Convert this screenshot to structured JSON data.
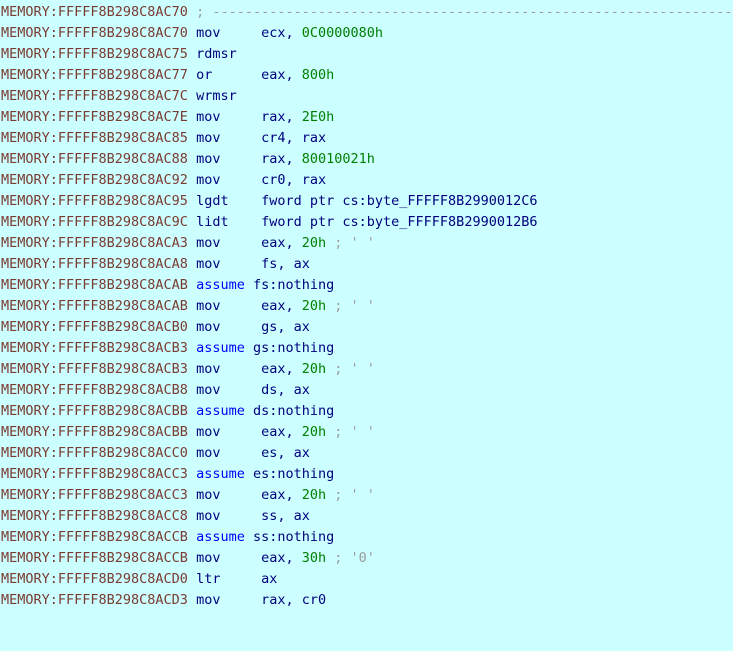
{
  "view": {
    "name": "IDA Pro disassembly listing",
    "segment": "MEMORY",
    "background_color": "#ccffff",
    "colors": {
      "segment_prefix": "#7a3b30",
      "mnemonic": "#00007f",
      "register": "#00007f",
      "number": "#008000",
      "keyword": "#0000ff",
      "comment": "#9a9a9a"
    }
  },
  "lines": [
    {
      "prefix": "MEMORY:FFFFF8B298C8AC70",
      "tokens": [
        {
          "t": "comment",
          "v": "; ---------------------------------------------------------------------------"
        }
      ]
    },
    {
      "prefix": "MEMORY:FFFFF8B298C8AC70",
      "tokens": [
        {
          "t": "mnem",
          "v": "mov     "
        },
        {
          "t": "reg",
          "v": "ecx, "
        },
        {
          "t": "num",
          "v": "0C0000080h"
        }
      ]
    },
    {
      "prefix": "MEMORY:FFFFF8B298C8AC75",
      "tokens": [
        {
          "t": "mnem",
          "v": "rdmsr"
        }
      ]
    },
    {
      "prefix": "MEMORY:FFFFF8B298C8AC77",
      "tokens": [
        {
          "t": "mnem",
          "v": "or      "
        },
        {
          "t": "reg",
          "v": "eax, "
        },
        {
          "t": "num",
          "v": "800h"
        }
      ]
    },
    {
      "prefix": "MEMORY:FFFFF8B298C8AC7C",
      "tokens": [
        {
          "t": "mnem",
          "v": "wrmsr"
        }
      ]
    },
    {
      "prefix": "MEMORY:FFFFF8B298C8AC7E",
      "tokens": [
        {
          "t": "mnem",
          "v": "mov     "
        },
        {
          "t": "reg",
          "v": "rax, "
        },
        {
          "t": "num",
          "v": "2E0h"
        }
      ]
    },
    {
      "prefix": "MEMORY:FFFFF8B298C8AC85",
      "tokens": [
        {
          "t": "mnem",
          "v": "mov     "
        },
        {
          "t": "reg",
          "v": "cr4, rax"
        }
      ]
    },
    {
      "prefix": "MEMORY:FFFFF8B298C8AC88",
      "tokens": [
        {
          "t": "mnem",
          "v": "mov     "
        },
        {
          "t": "reg",
          "v": "rax, "
        },
        {
          "t": "num",
          "v": "80010021h"
        }
      ]
    },
    {
      "prefix": "MEMORY:FFFFF8B298C8AC92",
      "tokens": [
        {
          "t": "mnem",
          "v": "mov     "
        },
        {
          "t": "reg",
          "v": "cr0, rax"
        }
      ]
    },
    {
      "prefix": "MEMORY:FFFFF8B298C8AC95",
      "tokens": [
        {
          "t": "mnem",
          "v": "lgdt    "
        },
        {
          "t": "reg",
          "v": "fword ptr cs:"
        },
        {
          "t": "name",
          "v": "byte_FFFFF8B2990012C6"
        }
      ]
    },
    {
      "prefix": "MEMORY:FFFFF8B298C8AC9C",
      "tokens": [
        {
          "t": "mnem",
          "v": "lidt    "
        },
        {
          "t": "reg",
          "v": "fword ptr cs:"
        },
        {
          "t": "name",
          "v": "byte_FFFFF8B2990012B6"
        }
      ]
    },
    {
      "prefix": "MEMORY:FFFFF8B298C8ACA3",
      "tokens": [
        {
          "t": "mnem",
          "v": "mov     "
        },
        {
          "t": "reg",
          "v": "eax, "
        },
        {
          "t": "num",
          "v": "20h"
        },
        {
          "t": "comment",
          "v": " ; ' '"
        }
      ]
    },
    {
      "prefix": "MEMORY:FFFFF8B298C8ACA8",
      "tokens": [
        {
          "t": "mnem",
          "v": "mov     "
        },
        {
          "t": "reg",
          "v": "fs, ax"
        }
      ]
    },
    {
      "prefix": "MEMORY:FFFFF8B298C8ACAB",
      "tokens": [
        {
          "t": "keyword",
          "v": "assume "
        },
        {
          "t": "dirtext",
          "v": "fs:nothing"
        }
      ]
    },
    {
      "prefix": "MEMORY:FFFFF8B298C8ACAB",
      "tokens": [
        {
          "t": "mnem",
          "v": "mov     "
        },
        {
          "t": "reg",
          "v": "eax, "
        },
        {
          "t": "num",
          "v": "20h"
        },
        {
          "t": "comment",
          "v": " ; ' '"
        }
      ]
    },
    {
      "prefix": "MEMORY:FFFFF8B298C8ACB0",
      "tokens": [
        {
          "t": "mnem",
          "v": "mov     "
        },
        {
          "t": "reg",
          "v": "gs, ax"
        }
      ]
    },
    {
      "prefix": "MEMORY:FFFFF8B298C8ACB3",
      "tokens": [
        {
          "t": "keyword",
          "v": "assume "
        },
        {
          "t": "dirtext",
          "v": "gs:nothing"
        }
      ]
    },
    {
      "prefix": "MEMORY:FFFFF8B298C8ACB3",
      "tokens": [
        {
          "t": "mnem",
          "v": "mov     "
        },
        {
          "t": "reg",
          "v": "eax, "
        },
        {
          "t": "num",
          "v": "20h"
        },
        {
          "t": "comment",
          "v": " ; ' '"
        }
      ]
    },
    {
      "prefix": "MEMORY:FFFFF8B298C8ACB8",
      "tokens": [
        {
          "t": "mnem",
          "v": "mov     "
        },
        {
          "t": "reg",
          "v": "ds, ax"
        }
      ]
    },
    {
      "prefix": "MEMORY:FFFFF8B298C8ACBB",
      "tokens": [
        {
          "t": "keyword",
          "v": "assume "
        },
        {
          "t": "dirtext",
          "v": "ds:nothing"
        }
      ]
    },
    {
      "prefix": "MEMORY:FFFFF8B298C8ACBB",
      "tokens": [
        {
          "t": "mnem",
          "v": "mov     "
        },
        {
          "t": "reg",
          "v": "eax, "
        },
        {
          "t": "num",
          "v": "20h"
        },
        {
          "t": "comment",
          "v": " ; ' '"
        }
      ]
    },
    {
      "prefix": "MEMORY:FFFFF8B298C8ACC0",
      "tokens": [
        {
          "t": "mnem",
          "v": "mov     "
        },
        {
          "t": "reg",
          "v": "es, ax"
        }
      ]
    },
    {
      "prefix": "MEMORY:FFFFF8B298C8ACC3",
      "tokens": [
        {
          "t": "keyword",
          "v": "assume "
        },
        {
          "t": "dirtext",
          "v": "es:nothing"
        }
      ]
    },
    {
      "prefix": "MEMORY:FFFFF8B298C8ACC3",
      "tokens": [
        {
          "t": "mnem",
          "v": "mov     "
        },
        {
          "t": "reg",
          "v": "eax, "
        },
        {
          "t": "num",
          "v": "20h"
        },
        {
          "t": "comment",
          "v": " ; ' '"
        }
      ]
    },
    {
      "prefix": "MEMORY:FFFFF8B298C8ACC8",
      "tokens": [
        {
          "t": "mnem",
          "v": "mov     "
        },
        {
          "t": "reg",
          "v": "ss, ax"
        }
      ]
    },
    {
      "prefix": "MEMORY:FFFFF8B298C8ACCB",
      "tokens": [
        {
          "t": "keyword",
          "v": "assume "
        },
        {
          "t": "dirtext",
          "v": "ss:nothing"
        }
      ]
    },
    {
      "prefix": "MEMORY:FFFFF8B298C8ACCB",
      "tokens": [
        {
          "t": "mnem",
          "v": "mov     "
        },
        {
          "t": "reg",
          "v": "eax, "
        },
        {
          "t": "num",
          "v": "30h"
        },
        {
          "t": "comment",
          "v": " ; '0'"
        }
      ]
    },
    {
      "prefix": "MEMORY:FFFFF8B298C8ACD0",
      "tokens": [
        {
          "t": "mnem",
          "v": "ltr     "
        },
        {
          "t": "reg",
          "v": "ax"
        }
      ]
    },
    {
      "prefix": "MEMORY:FFFFF8B298C8ACD3",
      "tokens": [
        {
          "t": "mnem",
          "v": "mov     "
        },
        {
          "t": "reg",
          "v": "rax, cr0"
        }
      ]
    }
  ]
}
